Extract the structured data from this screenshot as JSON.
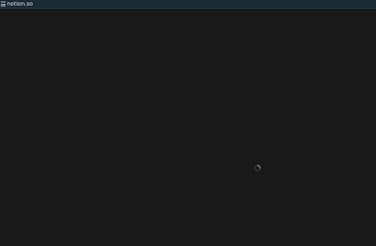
{
  "window": {
    "title": "notion.so"
  },
  "icons": {
    "menu": "menu-icon",
    "loading": "loading-spinner-icon"
  },
  "colors": {
    "topbar_bg": "#1c2a33",
    "page_bg": "#191919",
    "title_text": "#e6ecef",
    "spinner": "#9aa0a6"
  }
}
